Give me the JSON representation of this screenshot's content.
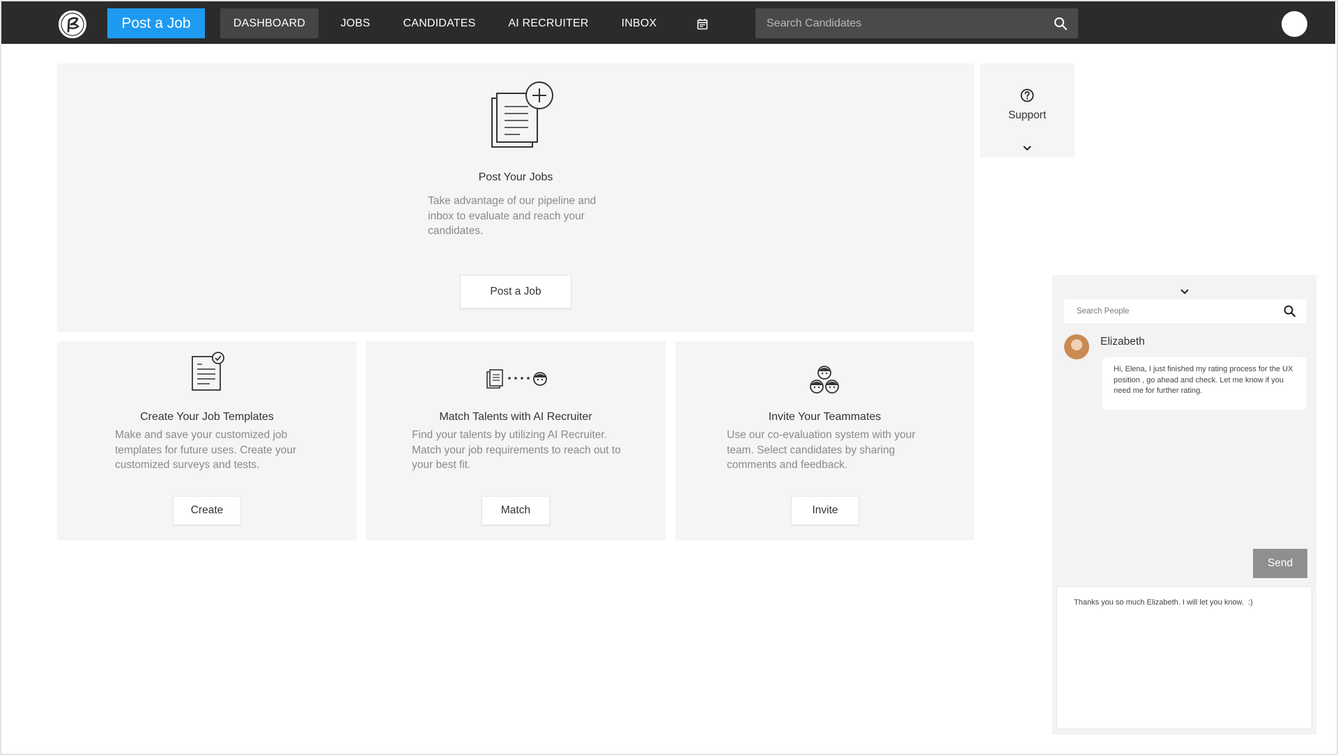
{
  "topnav": {
    "post_job_label": "Post a Job",
    "items": [
      {
        "label": "DASHBOARD"
      },
      {
        "label": "JOBS"
      },
      {
        "label": "CANDIDATES"
      },
      {
        "label": "AI RECRUITER"
      },
      {
        "label": "INBOX"
      }
    ],
    "active": "DASHBOARD",
    "search_placeholder": "Search Candidates",
    "icons": [
      "logo-icon",
      "calendar-icon",
      "search-icon",
      "avatar"
    ]
  },
  "hero": {
    "title": "Post Your Jobs",
    "description": "Take advantage of our pipeline and inbox to evaluate and reach your candidates.",
    "button": "Post a Job",
    "icon": "documents-add-icon"
  },
  "cards": [
    {
      "title": "Create Your Job Templates",
      "description": "Make and save your customized job templates for future uses. Create your customized surveys and tests.",
      "button": "Create",
      "icon": "template-check-icon"
    },
    {
      "title": "Match Talents with AI Recruiter",
      "description": "Find your talents by utilizing AI Recruiter. Match your job requirements to reach out to your best fit.",
      "button": "Match",
      "icon": "match-talent-icon"
    },
    {
      "title": "Invite Your Teammates",
      "description": "Use our co-evaluation system with your team. Select candidates by sharing comments and feedback.",
      "button": "Invite",
      "icon": "team-icon"
    }
  ],
  "support": {
    "label": "Support",
    "icon": "help-circle-icon"
  },
  "chat": {
    "search_placeholder": "Search People",
    "contact_name": "Elizabeth",
    "message": "Hi, Elena, I just finished my rating process for the UX position , go ahead and check. Let me know if you need me for further rating.",
    "send_label": "Send",
    "compose_text": "Thanks you so much Elizabeth. I will let you know.  :)"
  },
  "colors": {
    "nav_background": "#2b2b2b",
    "accent": "#1e9bf0",
    "card_background": "#f5f5f5",
    "send_button": "#8f8f8f"
  }
}
